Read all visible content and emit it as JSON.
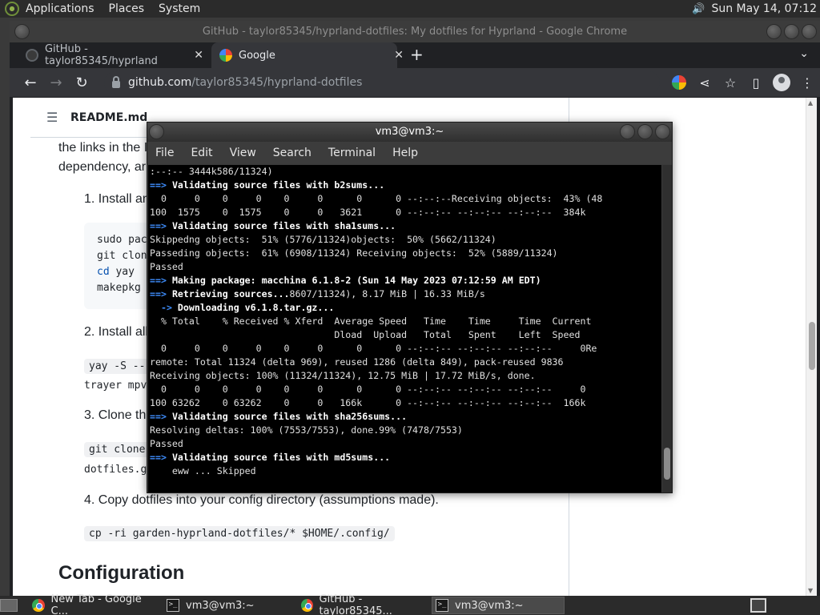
{
  "top_panel": {
    "menus": [
      "Applications",
      "Places",
      "System"
    ],
    "clock": "Sun May 14, 07:12"
  },
  "chrome": {
    "window_title": "GitHub - taylor85345/hyprland-dotfiles: My dotfiles for Hyprland - Google Chrome",
    "tabs": [
      {
        "label": "GitHub - taylor85345/hyprland",
        "icon": "github-icon"
      },
      {
        "label": "Google",
        "icon": "google-icon"
      }
    ],
    "url_host": "github.com",
    "url_path": "/taylor85345/hyprland-dotfiles"
  },
  "readme": {
    "file_title": "README.md",
    "para_line1": "the links in the I",
    "para_line2": "dependency, ar",
    "step1": "1. Install an A",
    "code1": [
      "sudo pac",
      "git clon",
      "yay",
      "makepkg"
    ],
    "code1_cd": "cd",
    "step2": "2. Install all re",
    "code2a": "yay -S --",
    "code2b": "trayer mpv",
    "step3": "3. Clone the r",
    "code3a": "git clone",
    "code3b": "dotfiles.g",
    "step4": "4. Copy dotfiles into your config directory (assumptions made).",
    "code4": "cp -ri garden-hyprland-dotfiles/* $HOME/.config/",
    "heading_config": "Configuration"
  },
  "terminal": {
    "title": "vm3@vm3:~",
    "menus": [
      "File",
      "Edit",
      "View",
      "Search",
      "Terminal",
      "Help"
    ],
    "lines": [
      {
        "t": ":--:-- 3444k586/11324)"
      },
      {
        "arrow": "==>",
        "b": "Validating source files with b2sums..."
      },
      {
        "t": "  0     0    0     0    0     0      0      0 --:--:--Receiving objects:  43% (48"
      },
      {
        "t": "100  1575    0  1575    0     0   3621      0 --:--:-- --:--:-- --:--:--  384k"
      },
      {
        "arrow": "==>",
        "b": "Validating source files with sha1sums..."
      },
      {
        "t": "Skippedng objects:  51% (5776/11324)objects:  50% (5662/11324)"
      },
      {
        "t": "Passeding objects:  61% (6908/11324) Receiving objects:  52% (5889/11324)"
      },
      {
        "t": "Passed"
      },
      {
        "arrow": "==>",
        "b": "Making package: macchina 6.1.8-2 (Sun 14 May 2023 07:12:59 AM EDT)"
      },
      {
        "arrow": "==>",
        "b": "Retrieving sources...",
        "t": "8607/11324), 8.17 MiB | 16.33 MiB/s"
      },
      {
        "arrow": "  ->",
        "b": "Downloading v6.1.8.tar.gz..."
      },
      {
        "t": "  % Total    % Received % Xferd  Average Speed   Time    Time     Time  Current"
      },
      {
        "t": "                                 Dload  Upload   Total   Spent    Left  Speed"
      },
      {
        "t": "  0     0    0     0    0     0      0      0 --:--:-- --:--:-- --:--:--     0Re"
      },
      {
        "t": "remote: Total 11324 (delta 969), reused 1286 (delta 849), pack-reused 9836"
      },
      {
        "t": "Receiving objects: 100% (11324/11324), 12.75 MiB | 17.72 MiB/s, done."
      },
      {
        "t": "  0     0    0     0    0     0      0      0 --:--:-- --:--:-- --:--:--     0"
      },
      {
        "t": "100 63262    0 63262    0     0   166k      0 --:--:-- --:--:-- --:--:--  166k"
      },
      {
        "arrow": "==>",
        "b": "Validating source files with sha256sums..."
      },
      {
        "t": "Resolving deltas: 100% (7553/7553), done.99% (7478/7553)"
      },
      {
        "t": "Passed"
      },
      {
        "arrow": "==>",
        "b": "Validating source files with md5sums..."
      },
      {
        "t": "    eww ... Skipped"
      }
    ]
  },
  "taskbar": {
    "tasks": [
      {
        "label": "New Tab - Google C...",
        "icon": "chrome-icon"
      },
      {
        "label": "vm3@vm3:~",
        "icon": "terminal-icon"
      },
      {
        "label": "GitHub - taylor85345...",
        "icon": "chrome-icon"
      },
      {
        "label": "vm3@vm3:~",
        "icon": "terminal-icon"
      }
    ]
  }
}
